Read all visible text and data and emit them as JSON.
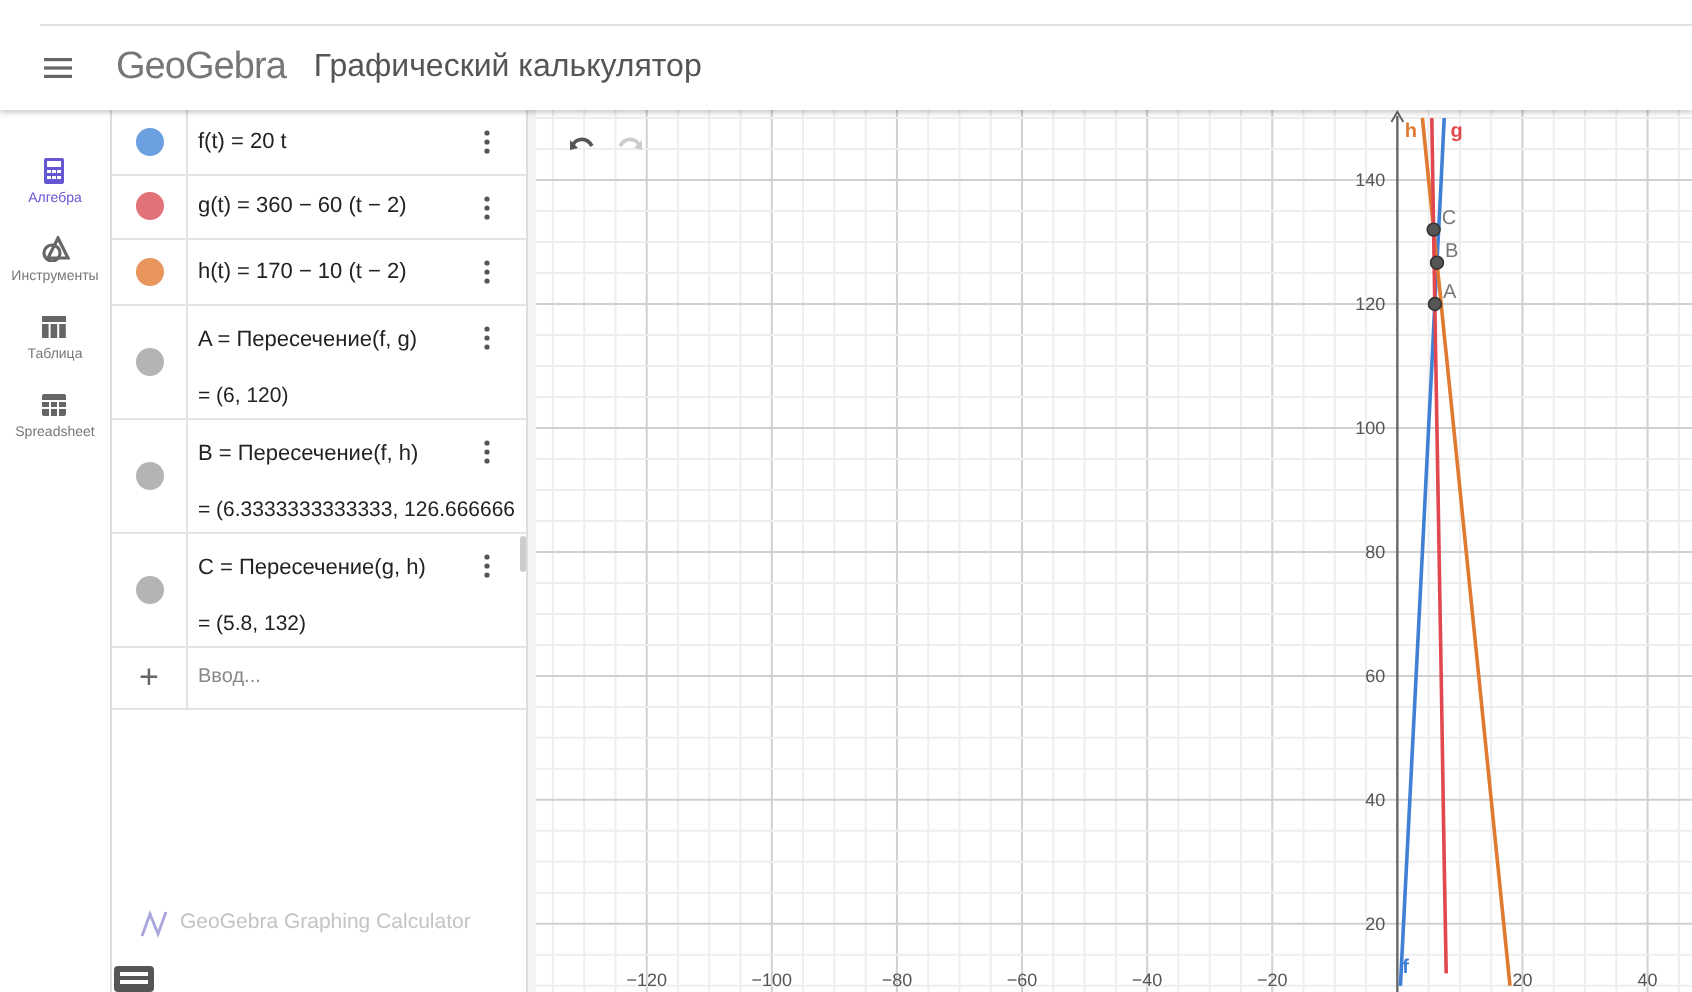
{
  "header": {
    "logo": "GeoGebra",
    "title": "Графический калькулятор"
  },
  "sidebar": {
    "items": [
      {
        "label": "Алгебра",
        "selected": true
      },
      {
        "label": "Инструменты",
        "selected": false
      },
      {
        "label": "Таблица",
        "selected": false
      },
      {
        "label": "Spreadsheet",
        "selected": false
      }
    ]
  },
  "algebra": {
    "items": [
      {
        "kind": "function",
        "color": "#6c9fe0",
        "definition": "f(t) = 20 t"
      },
      {
        "kind": "function",
        "color": "#e2727a",
        "definition": "g(t) = 360 − 60 (t − 2)"
      },
      {
        "kind": "function",
        "color": "#e8955e",
        "definition": "h(t) = 170 − 10 (t − 2)"
      },
      {
        "kind": "point",
        "color": "#b4b4b4",
        "definition": "A = Пересечение(f, g)",
        "value": "= (6, 120)"
      },
      {
        "kind": "point",
        "color": "#b4b4b4",
        "definition": "B = Пересечение(f, h)",
        "value": "= (6.3333333333333, 126.666666"
      },
      {
        "kind": "point",
        "color": "#b4b4b4",
        "definition": "C = Пересечение(g, h)",
        "value": "= (5.8, 132)"
      }
    ],
    "input": {
      "icon": "+",
      "placeholder": "Ввод..."
    },
    "footer": "GeoGebra Graphing Calculator"
  },
  "graphics": {
    "undo": {
      "disabled": false
    },
    "redo": {
      "disabled": true
    },
    "chart_data": {
      "type": "line",
      "grid": true,
      "x": [
        0.5,
        4,
        5,
        5.5,
        6,
        7,
        7.5,
        7.8,
        10,
        15,
        18
      ],
      "series": [
        {
          "name": "f",
          "color": "#3f7fd6",
          "values": [
            10,
            80,
            100,
            110,
            120,
            140,
            150,
            null,
            null,
            null,
            null
          ]
        },
        {
          "name": "h",
          "color": "#e07a30",
          "values": [
            null,
            150,
            140,
            135,
            130,
            120,
            115,
            112,
            90,
            40,
            10
          ]
        },
        {
          "name": "g",
          "color": "#e0474f",
          "values": [
            null,
            null,
            null,
            150,
            120,
            60,
            30,
            12,
            null,
            null,
            null
          ]
        }
      ],
      "xlim": [
        -137.7,
        48.7
      ],
      "ylim": [
        9,
        151.3
      ],
      "xticks": [
        -120,
        -100,
        -80,
        -60,
        -40,
        -20,
        20,
        40
      ],
      "yticks": [
        20,
        40,
        60,
        80,
        100,
        120,
        140
      ],
      "annotations": [
        {
          "x": 6,
          "y": 120,
          "text": "A"
        },
        {
          "x": 6.3333333333333,
          "y": 126.666666,
          "text": "B"
        },
        {
          "x": 5.8,
          "y": 132,
          "text": "C"
        }
      ]
    }
  }
}
